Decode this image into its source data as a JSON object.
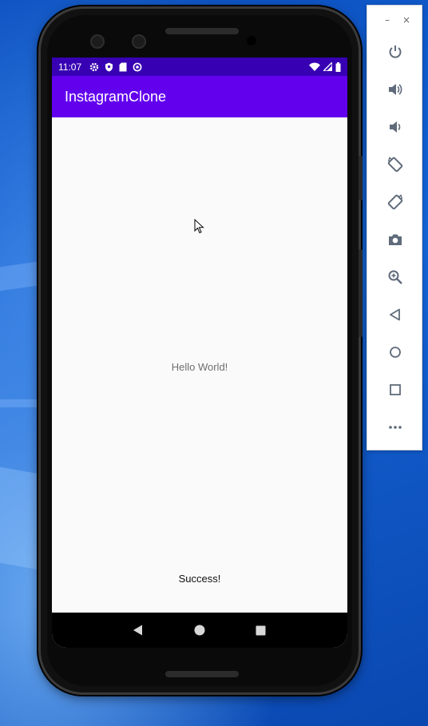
{
  "statusbar": {
    "time": "11:07"
  },
  "app": {
    "title": "InstagramClone"
  },
  "content": {
    "hello": "Hello World!",
    "success": "Success!"
  },
  "colors": {
    "primary": "#6200ee",
    "primary_dark": "#3700b3",
    "desktop": "#1463d4"
  },
  "emulator_toolbar": {
    "window_controls": {
      "minimize": "–",
      "close": "×"
    },
    "items": [
      "power-icon",
      "volume-up-icon",
      "volume-down-icon",
      "rotate-left-icon",
      "rotate-right-icon",
      "camera-icon",
      "zoom-icon",
      "back-icon",
      "home-icon",
      "overview-icon",
      "more-icon"
    ]
  }
}
